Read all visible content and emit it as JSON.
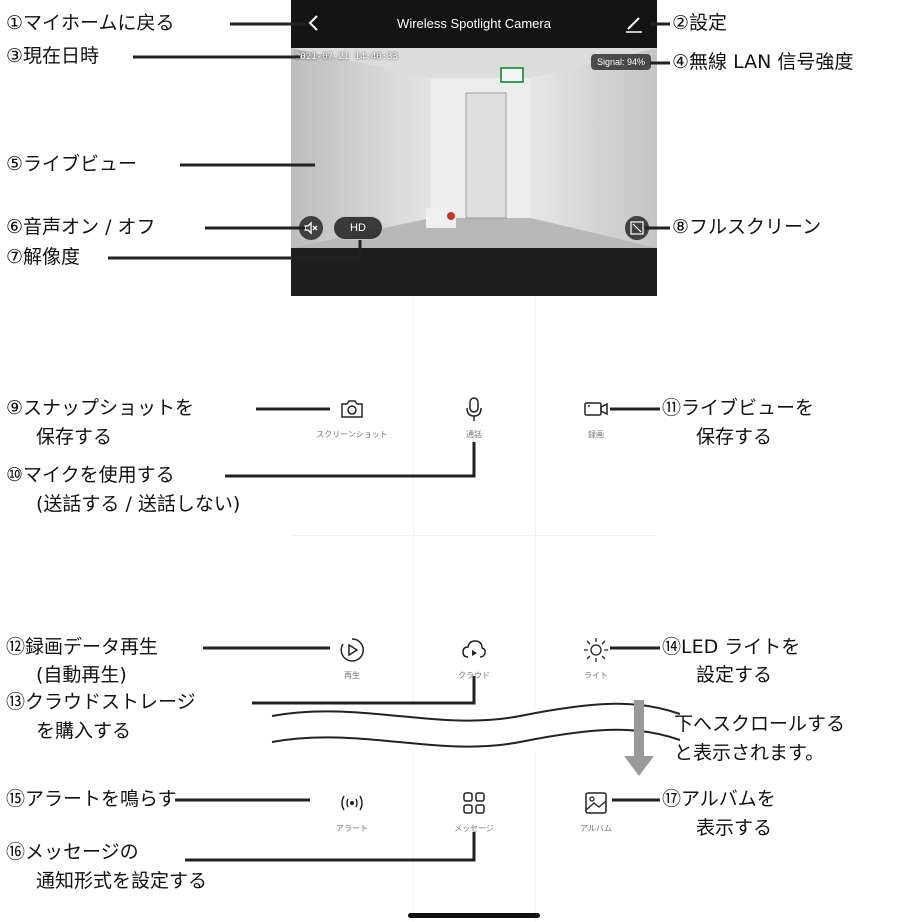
{
  "app": {
    "title": "Wireless Spotlight Camera",
    "timestamp": "2021-07-21 14:40:33",
    "signal": "Signal: 94%",
    "resolution": "HD"
  },
  "features": [
    {
      "label": "スクリーンショット",
      "icon": "camera-icon"
    },
    {
      "label": "通話",
      "icon": "microphone-icon"
    },
    {
      "label": "録画",
      "icon": "video-camera-icon"
    },
    {
      "label": "再生",
      "icon": "play-icon"
    },
    {
      "label": "クラウド",
      "icon": "cloud-icon"
    },
    {
      "label": "ライト",
      "icon": "light-icon"
    },
    {
      "label": "アラート",
      "icon": "alarm-icon"
    },
    {
      "label": "メッセージ",
      "icon": "message-grid-icon"
    },
    {
      "label": "アルバム",
      "icon": "album-icon"
    }
  ],
  "annotations": {
    "a1": "①マイホームに戻る",
    "a2": "②設定",
    "a3": "③現在日時",
    "a4": "④無線 LAN 信号強度",
    "a5": "⑤ライブビュー",
    "a6": "⑥音声オン / オフ",
    "a7": "⑦解像度",
    "a8": "⑧フルスクリーン",
    "a9": "⑨スナップショットを",
    "a9b": "保存する",
    "a10": "⑩マイクを使用する",
    "a10b": "(送話する / 送話しない)",
    "a11": "⑪ライブビューを",
    "a11b": "保存する",
    "a12": "⑫録画データ再生",
    "a12b": "(自動再生)",
    "a13": "⑬クラウドストレージ",
    "a13b": "を購入する",
    "a14": "⑭LED ライトを",
    "a14b": "設定する",
    "a15": "⑮アラートを鳴らす",
    "a16": "⑯メッセージの",
    "a16b": "通知形式を設定する",
    "a17": "⑰アルバムを",
    "a17b": "表示する",
    "scroll1": "下へスクロールする",
    "scroll2": "と表示されます。"
  },
  "colors": {
    "header_bg": "#141414",
    "band_bg": "#1e1e1e",
    "annotation_line": "#222222",
    "scroll_arrow": "#9a9a9a"
  }
}
